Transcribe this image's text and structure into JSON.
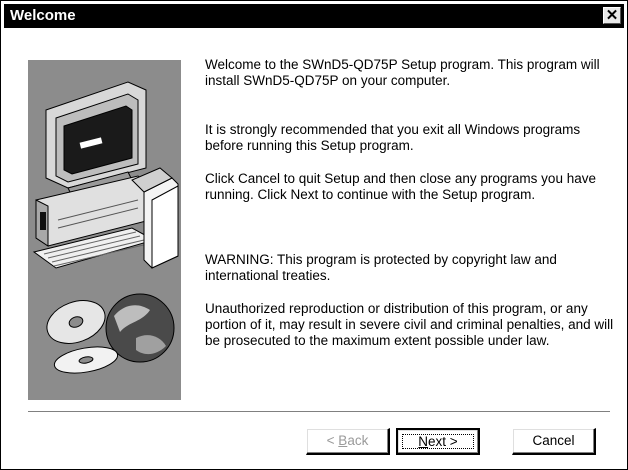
{
  "window": {
    "title": "Welcome",
    "close_glyph": "✕"
  },
  "paragraphs": [
    "Welcome to the SWnD5-QD75P Setup program.  This program will install SWnD5-QD75P on your computer.",
    "It is strongly recommended that you exit all Windows programs before running this Setup program.",
    "Click Cancel to quit Setup and then close any programs you have running.  Click Next to continue with the Setup program.",
    "WARNING: This program is protected by copyright law and international treaties.",
    "Unauthorized reproduction or distribution of this program, or any portion of it, may result in severe civil and criminal penalties, and will be prosecuted to the maximum extent possible under law."
  ],
  "buttons": {
    "back": {
      "prefix": "< ",
      "mnemonic": "B",
      "rest": "ack",
      "enabled": false
    },
    "next": {
      "mnemonic": "N",
      "rest": "ext >",
      "enabled": true,
      "default": true
    },
    "cancel": {
      "label": "Cancel",
      "enabled": true
    }
  },
  "colors": {
    "titlebar": "#000000",
    "panel": "#8c8c8c",
    "disabled_text": "#9a9a9a"
  },
  "illustration": "computer-setup-illustration"
}
